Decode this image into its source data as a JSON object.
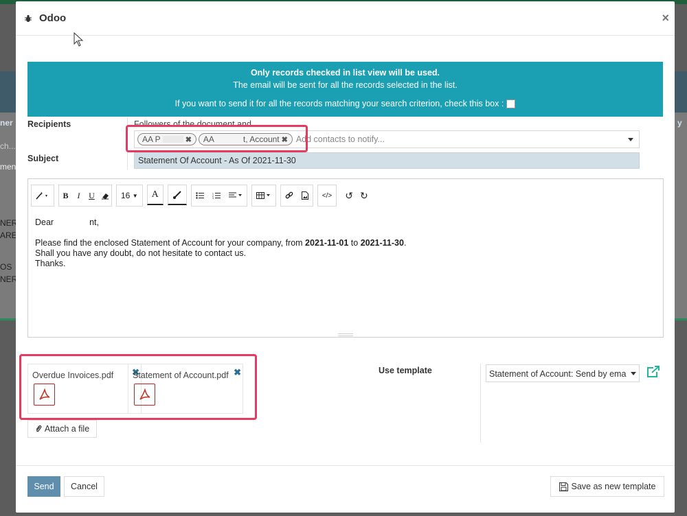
{
  "background": {
    "left_fragments": [
      "ner",
      "ch...",
      "ment",
      "NERY",
      "ARE",
      "OS",
      "NERY"
    ],
    "right_fragments": [
      "y"
    ]
  },
  "modal": {
    "title": "Odoo",
    "close_label": "×"
  },
  "alert": {
    "line1": "Only records checked in list view will be used.",
    "line2": "The email will be sent for all the records selected in the list.",
    "line3": "If you want to send it for all the records matching your search criterion, check this box :"
  },
  "recipients": {
    "label": "Recipients",
    "followers_text": "Followers of the document and",
    "tags": [
      "AA P",
      "AA ",
      "t, Account"
    ],
    "placeholder": "Add contacts to notify..."
  },
  "subject": {
    "label": "Subject",
    "value": "Statement Of Account - As Of 2021-11-30"
  },
  "toolbar": {
    "font_size": "16",
    "bold": "B",
    "italic": "I",
    "underline": "U",
    "color_letter": "A"
  },
  "body": {
    "greeting_start": "Dear",
    "greeting_end": "nt,",
    "line1_a": "Please find the enclosed Statement of Account for your company, from ",
    "date_from": "2021-11-01",
    "line1_b": " to ",
    "date_to": "2021-11-30",
    "line1_c": ".",
    "line2": "Shall you have any doubt, do not hesitate to contact us.",
    "line3": "Thanks."
  },
  "attachments": [
    {
      "name": "Overdue Invoices.pdf"
    },
    {
      "name": "Statement of Account.pdf"
    }
  ],
  "attach_label": "Attach a file",
  "template": {
    "label": "Use template",
    "selected": "Statement of Account: Send by ema"
  },
  "footer": {
    "send": "Send",
    "cancel": "Cancel",
    "save_template": "Save as new template"
  },
  "colors": {
    "alert_bg": "#1b9fb3",
    "highlight": "#e8395e",
    "send_bg": "#5f8fad",
    "link_green": "#21b799"
  }
}
